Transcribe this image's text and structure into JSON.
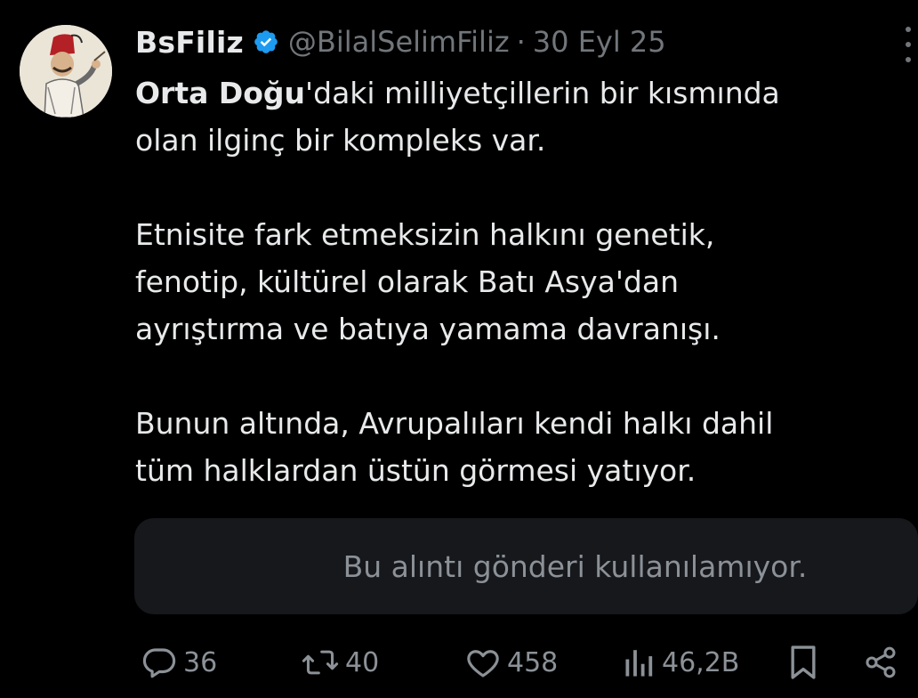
{
  "tweet": {
    "display_name": "BsFiliz",
    "handle": "@BilalSelimFiliz",
    "separator": "·",
    "date": "30 Eyl 25",
    "lines": {
      "p1_bold": "Orta Doğu",
      "p1_rest": "'daki milliyetçillerin bir kısmında",
      "p1_line2": "olan ilginç bir kompleks var.",
      "p2_line1": "Etnisite fark etmeksizin halkını genetik,",
      "p2_line2": "fenotip, kültürel olarak Batı Asya'dan",
      "p2_line3": "ayrıştırma ve batıya yamama davranışı.",
      "p3_line1": "Bunun altında, Avrupalıları kendi halkı dahil",
      "p3_line2": "tüm halklardan üstün görmesi yatıyor."
    },
    "quote_unavailable": "Bu alıntı gönderi kullanılamıyor.",
    "metrics": {
      "replies": "36",
      "reposts": "40",
      "likes": "458",
      "views": "46,2B"
    }
  },
  "icons": {
    "verified": "verified-badge-icon",
    "more": "more-options-icon",
    "reply": "reply-icon",
    "repost": "repost-icon",
    "like": "heart-icon",
    "views": "views-bar-chart-icon",
    "bookmark": "bookmark-icon",
    "share": "share-icon"
  },
  "colors": {
    "background": "#000000",
    "text": "#e7e9ea",
    "secondary": "#71767b",
    "verified_blue": "#1d9bf0",
    "quote_box": "#16181c"
  }
}
